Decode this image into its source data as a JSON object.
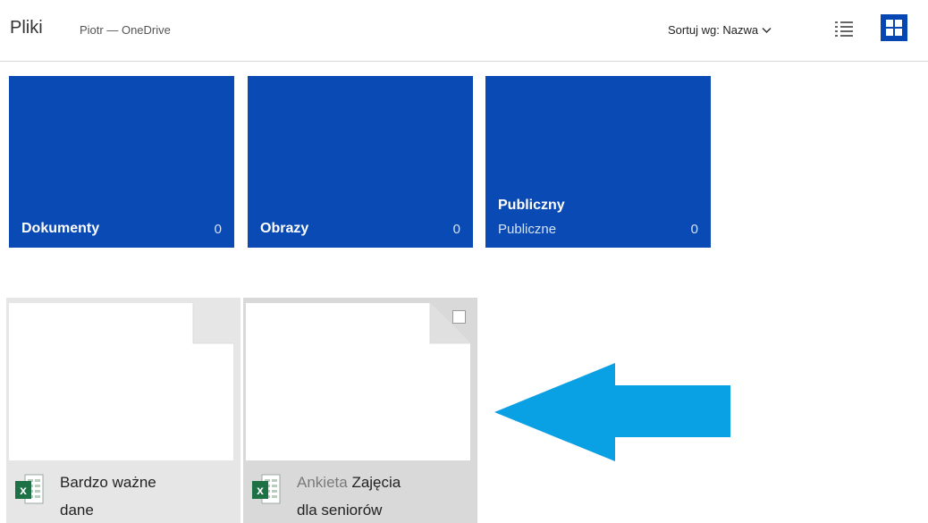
{
  "header": {
    "title": "Pliki",
    "subtitle": "Piotr — OneDrive",
    "sort_label": "Sortuj wg: Nazwa"
  },
  "folders": [
    {
      "name": "Dokumenty",
      "subtitle": "",
      "count": "0"
    },
    {
      "name": "Obrazy",
      "subtitle": "",
      "count": "0"
    },
    {
      "name": "Publiczny",
      "subtitle": "Publiczne",
      "count": "0"
    }
  ],
  "files": [
    {
      "line1": "Bardzo ważne",
      "line1_prefix": "",
      "line2": "dane",
      "icon": "excel-icon"
    },
    {
      "line1": "Zajęcia",
      "line1_prefix": "Ankieta ",
      "line2": "dla seniorów",
      "icon": "excel-icon"
    }
  ],
  "colors": {
    "accent": "#0a4ab5",
    "arrow": "#0aa0e4",
    "excel": "#1e7145"
  }
}
